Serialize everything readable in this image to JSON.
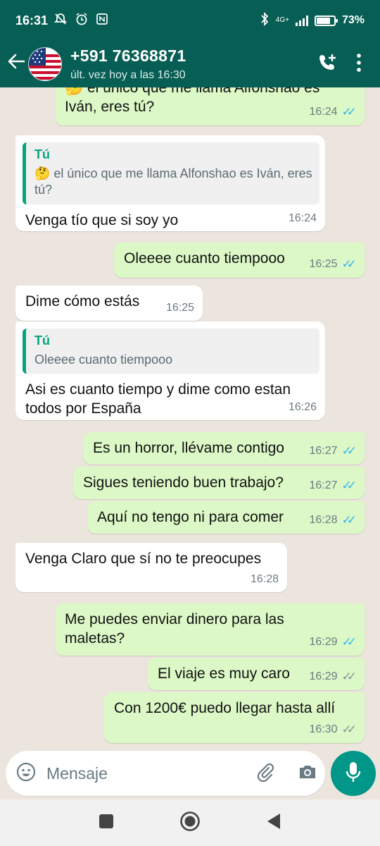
{
  "status_bar": {
    "time": "16:31",
    "network": "4G+",
    "battery_percent": "73%",
    "battery_level": 0.73
  },
  "header": {
    "contact_name": "+591 76368871",
    "last_seen": "últ. vez hoy a las 16:30",
    "icons": [
      "back-arrow-icon",
      "add-call-icon",
      "more-options-icon"
    ],
    "brand_color": "#075E54"
  },
  "messages": [
    {
      "direction": "out",
      "text": "🤔 el único que me llama Alfonshao es Iván, eres tú?",
      "time": "16:24",
      "ticks": "read"
    },
    {
      "direction": "in",
      "quote_author": "Tú",
      "quote_text": "🤔 el único que me llama Alfonshao es Iván, eres tú?",
      "text": "Venga tío que si soy yo",
      "time": "16:24"
    },
    {
      "direction": "out",
      "text": "Oleeee cuanto tiempooo",
      "time": "16:25",
      "ticks": "read"
    },
    {
      "direction": "in",
      "text": "Dime cómo estás",
      "time": "16:25"
    },
    {
      "direction": "in",
      "quote_author": "Tú",
      "quote_text": "Oleeee cuanto tiempooo",
      "text": "Asi es cuanto tiempo y dime como estan todos por España",
      "time": "16:26"
    },
    {
      "direction": "out",
      "text": "Es un horror, llévame contigo",
      "time": "16:27",
      "ticks": "read"
    },
    {
      "direction": "out",
      "text": "Sigues teniendo buen trabajo?",
      "time": "16:27",
      "ticks": "read"
    },
    {
      "direction": "out",
      "text": "Aquí no tengo ni para comer",
      "time": "16:28",
      "ticks": "read"
    },
    {
      "direction": "in",
      "text": "Venga Claro que sí no te preocupes",
      "time": "16:28"
    },
    {
      "direction": "out",
      "text": "Me puedes enviar dinero para las maletas?",
      "time": "16:29",
      "ticks": "read"
    },
    {
      "direction": "out",
      "text": "El viaje es muy caro",
      "time": "16:29",
      "ticks": "sent"
    },
    {
      "direction": "out",
      "text": "Con 1200€ puedo llegar hasta allí",
      "time": "16:30",
      "ticks": "sent"
    }
  ],
  "composer": {
    "placeholder": "Mensaje",
    "icons": [
      "emoji-icon",
      "attach-icon",
      "camera-icon",
      "mic-icon"
    ],
    "accent": "#009688"
  },
  "colors": {
    "outgoing_bubble": "#DCF8C6",
    "incoming_bubble": "#FFFFFF",
    "read_ticks": "#34B7F1",
    "quote_accent": "#06A37F"
  }
}
